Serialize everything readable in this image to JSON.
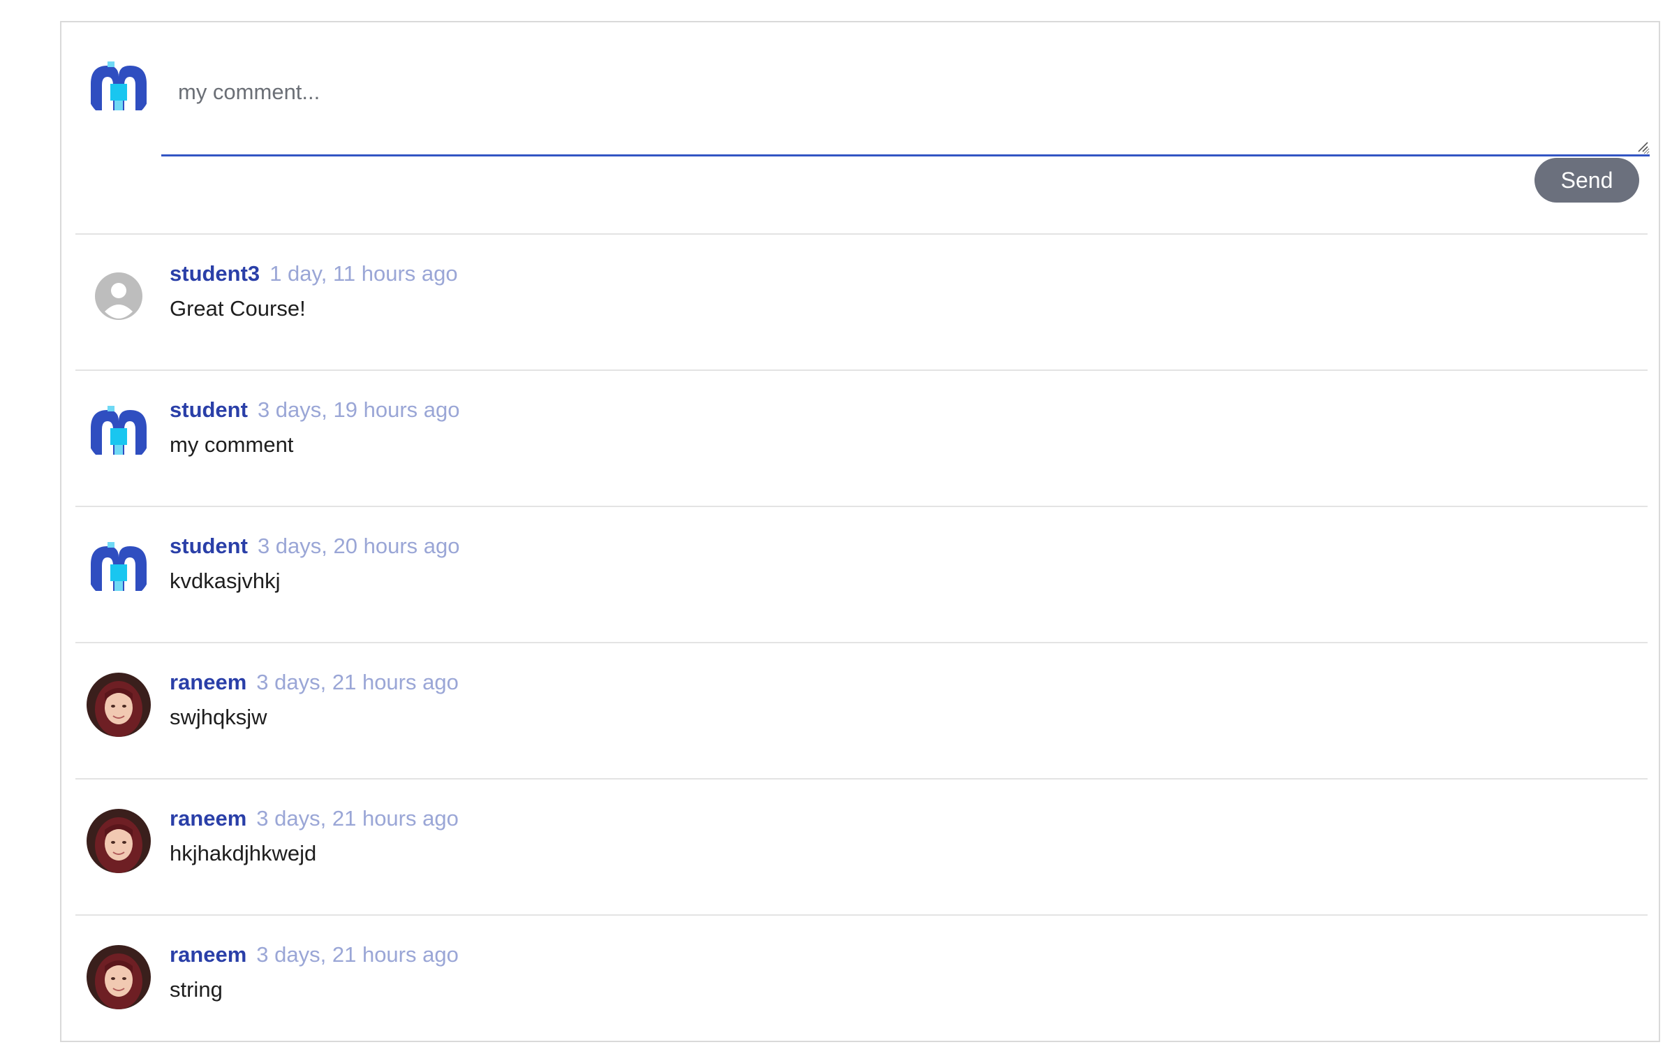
{
  "composer": {
    "placeholder": "my comment...",
    "value": "",
    "send_label": "Send",
    "avatar_icon": "brand-logo-avatar"
  },
  "colors": {
    "accent": "#3355c4",
    "author": "#2a3fa8",
    "timestamp": "#9aa6d6",
    "send_button": "#6b707d",
    "divider": "#e3e3e3"
  },
  "comments": [
    {
      "author": "student3",
      "time": "1 day, 11 hours ago",
      "text": "Great Course!",
      "avatar": "default-user-icon"
    },
    {
      "author": "student",
      "time": "3 days, 19 hours ago",
      "text": "my comment",
      "avatar": "brand-logo-avatar"
    },
    {
      "author": "student",
      "time": "3 days, 20 hours ago",
      "text": "kvdkasjvhkj",
      "avatar": "brand-logo-avatar"
    },
    {
      "author": "raneem",
      "time": "3 days, 21 hours ago",
      "text": "swjhqksjw",
      "avatar": "profile-photo"
    },
    {
      "author": "raneem",
      "time": "3 days, 21 hours ago",
      "text": "hkjhakdjhkwejd",
      "avatar": "profile-photo"
    },
    {
      "author": "raneem",
      "time": "3 days, 21 hours ago",
      "text": "string",
      "avatar": "profile-photo"
    }
  ]
}
